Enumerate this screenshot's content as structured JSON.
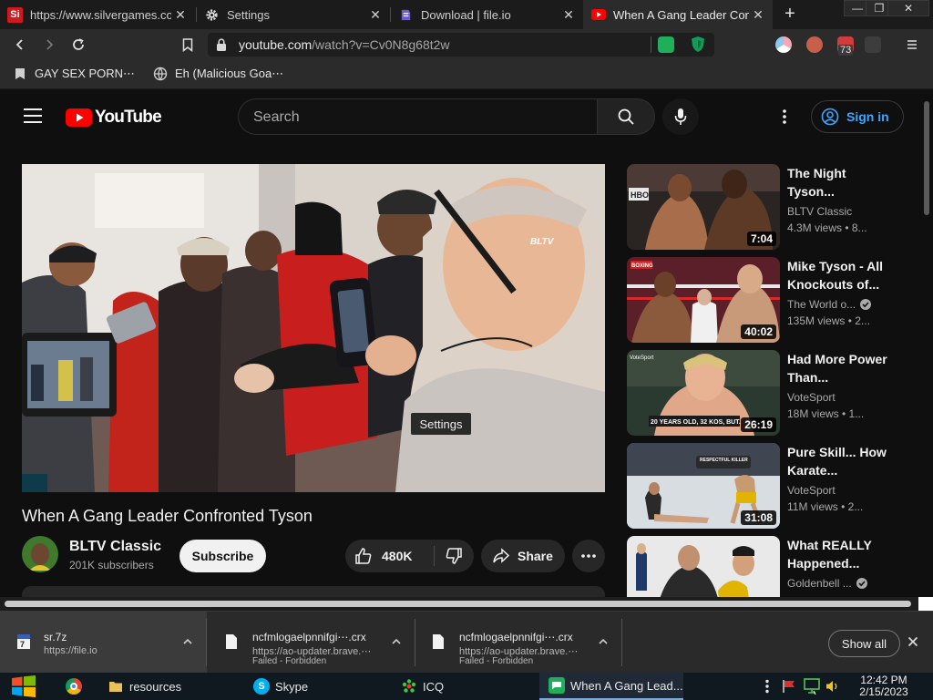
{
  "browser": {
    "tabs": [
      {
        "title": "https://www.silvergames.co",
        "icon": "silvergames-icon",
        "active": false
      },
      {
        "title": "Settings",
        "icon": "gear-icon",
        "active": false
      },
      {
        "title": "Download | file.io",
        "icon": "fileio-icon",
        "active": false
      },
      {
        "title": "When A Gang Leader Confront",
        "icon": "youtube-icon",
        "active": true
      }
    ],
    "close_glyph": "✕",
    "new_tab_glyph": "+",
    "window_controls": {
      "minimize": "—",
      "restore": "❐",
      "close": "✕"
    },
    "url_host": "youtube.com",
    "url_path": "/watch?v=Cv0N8g68t2w",
    "extension_badge": "73",
    "bookmarks": [
      {
        "label": "GAY SEX PORN⋯",
        "icon": "bookmark-icon"
      },
      {
        "label": "Eh (Malicious Goa⋯",
        "icon": "globe-icon"
      }
    ]
  },
  "youtube": {
    "logo_text": "YouTube",
    "search_placeholder": "Search",
    "sign_in": "Sign in",
    "video": {
      "title": "When A Gang Leader Confronted Tyson",
      "watermark": "BLTV",
      "tooltip": "Settings",
      "channel": "BLTV Classic",
      "subscribers": "201K subscribers",
      "subscribe_label": "Subscribe",
      "likes": "480K",
      "share_label": "Share"
    },
    "recommendations": [
      {
        "title": "The Night Tyson...",
        "channel": "BLTV Classic",
        "verified": false,
        "meta": "4.3M views • 8...",
        "duration": "7:04"
      },
      {
        "title": "Mike Tyson - All Knockouts of...",
        "channel": "The World o...",
        "verified": true,
        "meta": "135M views • 2...",
        "duration": "40:02"
      },
      {
        "title": "Had More Power Than...",
        "channel": "VoteSport",
        "verified": false,
        "meta": "18M views • 1...",
        "duration": "26:19"
      },
      {
        "title": "Pure Skill... How Karate...",
        "channel": "VoteSport",
        "verified": false,
        "meta": "11M views • 2...",
        "duration": "31:08"
      },
      {
        "title": "What REALLY Happened...",
        "channel": "Goldenbell ...",
        "verified": true,
        "meta": "",
        "duration": ""
      }
    ],
    "thumb_captions": {
      "hbo": "HBO",
      "ppv": "BOXING",
      "votesport": "VoteSport",
      "plate": "20 YEARS OLD, 32 KOS, BUT... W",
      "respectful": "RESPECTFUL KILLER"
    }
  },
  "downloads": {
    "items": [
      {
        "name": "sr.7z",
        "source": "https://file.io",
        "status": ""
      },
      {
        "name": "ncfmlogaelpnnifgi⋯.crx",
        "source": "https://ao-updater.brave.⋯",
        "status": "Failed - Forbidden"
      },
      {
        "name": "ncfmlogaelpnnifgi⋯.crx",
        "source": "https://ao-updater.brave.⋯",
        "status": "Failed - Forbidden"
      }
    ],
    "show_all": "Show all"
  },
  "taskbar": {
    "items": [
      {
        "label": "",
        "icon": "chrome-icon"
      },
      {
        "label": "resources",
        "icon": "folder-icon"
      },
      {
        "label": "Skype",
        "icon": "skype-icon"
      },
      {
        "label": "ICQ",
        "icon": "icq-icon"
      },
      {
        "label": "When A Gang Lead...",
        "icon": "browser-app-icon"
      }
    ],
    "time": "12:42 PM",
    "date": "2/15/2023"
  },
  "colors": {
    "accent_blue": "#3ea6ff",
    "youtube_red": "#ff0000",
    "background": "#0f0f0f"
  }
}
